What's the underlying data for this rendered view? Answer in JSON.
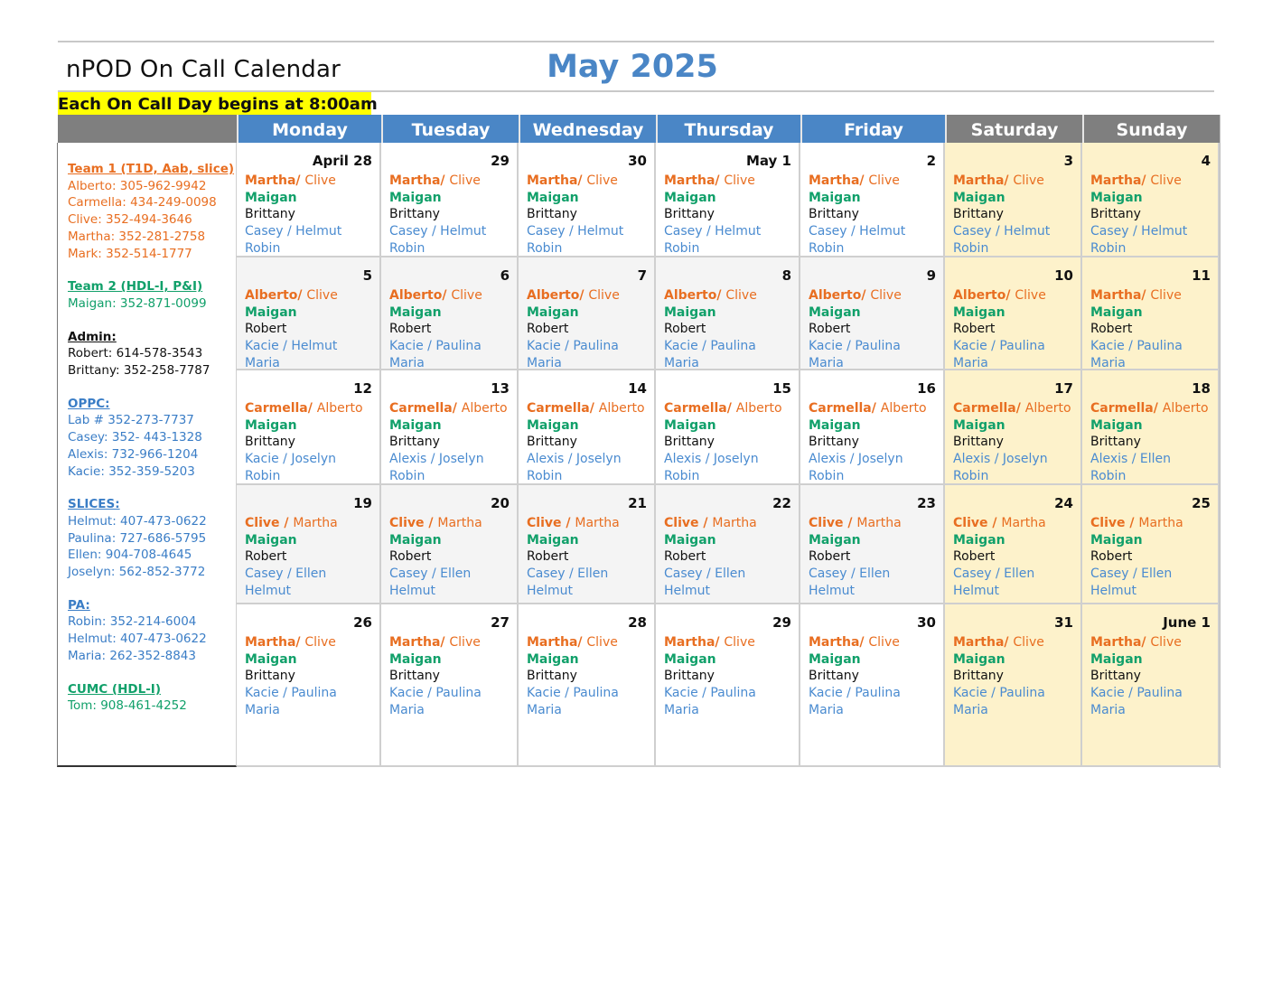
{
  "header": {
    "doc_title": "nPOD On Call Calendar",
    "month_title": "May 2025",
    "note": "Each On Call Day begins at 8:00am"
  },
  "day_names": [
    "Monday",
    "Tuesday",
    "Wednesday",
    "Thursday",
    "Friday",
    "Saturday",
    "Sunday"
  ],
  "contacts": {
    "team1": {
      "heading": "Team 1 (T1D, Aab, slice)",
      "lines": [
        "Alberto: 305-962-9942",
        "Carmella:  434-249-0098",
        "Clive: 352-494-3646",
        "Martha: 352-281-2758",
        "Mark: 352-514-1777"
      ]
    },
    "team2": {
      "heading": "Team 2 (HDL-I, P&I)",
      "lines": [
        "Maigan: 352-871-0099"
      ]
    },
    "admin": {
      "heading": "Admin:",
      "lines": [
        "Robert: 614-578-3543",
        "Brittany: 352-258-7787"
      ]
    },
    "oppc": {
      "heading": "OPPC:",
      "lines": [
        "Lab # 352-273-7737",
        "Casey: 352- 443-1328",
        "Alexis: 732-966-1204",
        "Kacie: 352-359-5203"
      ]
    },
    "slices": {
      "heading": "SLICES:",
      "lines": [
        "Helmut: 407-473-0622",
        "Paulina: 727-686-5795",
        "Ellen: 904-708-4645",
        "Joselyn:  562-852-3772"
      ]
    },
    "pa": {
      "heading": "PA:",
      "lines": [
        "Robin: 352-214-6004",
        "Helmut:  407-473-0622",
        "Maria: 262-352-8843"
      ]
    },
    "cumc": {
      "heading": "CUMC (HDL-I)",
      "lines": [
        "Tom: 908-461-4252"
      ]
    }
  },
  "weeks": [
    [
      {
        "date": "April 28",
        "lead": "Martha",
        "sep": "/ ",
        "second": "Clive",
        "l2": "Maigan",
        "l3": "Brittany",
        "l4": "Casey / Helmut",
        "l5": "Robin"
      },
      {
        "date": "29",
        "lead": "Martha",
        "sep": "/ ",
        "second": "Clive",
        "l2": "Maigan",
        "l3": "Brittany",
        "l4": "Casey / Helmut",
        "l5": "Robin"
      },
      {
        "date": "30",
        "lead": "Martha",
        "sep": "/ ",
        "second": "Clive",
        "l2": "Maigan",
        "l3": "Brittany",
        "l4": "Casey / Helmut",
        "l5": "Robin"
      },
      {
        "date": "May 1",
        "lead": "Martha",
        "sep": "/ ",
        "second": "Clive",
        "l2": "Maigan",
        "l3": "Brittany",
        "l4": "Casey / Helmut",
        "l5": "Robin"
      },
      {
        "date": "2",
        "lead": "Martha",
        "sep": "/ ",
        "second": "Clive",
        "l2": "Maigan",
        "l3": "Brittany",
        "l4": "Casey / Helmut",
        "l5": "Robin"
      },
      {
        "date": "3",
        "lead": "Martha",
        "sep": "/ ",
        "second": "Clive",
        "l2": "Maigan",
        "l3": "Brittany",
        "l4": "Casey / Helmut",
        "l5": "Robin"
      },
      {
        "date": "4",
        "lead": "Martha",
        "sep": "/ ",
        "second": "Clive",
        "l2": "Maigan",
        "l3": "Brittany",
        "l4": "Casey / Helmut",
        "l5": "Robin"
      }
    ],
    [
      {
        "date": "5",
        "lead": "Alberto",
        "sep": "/ ",
        "second": "Clive",
        "l2": "Maigan",
        "l3": "Robert",
        "l4": "Kacie / Helmut",
        "l5": "Maria"
      },
      {
        "date": "6",
        "lead": "Alberto",
        "sep": "/ ",
        "second": "Clive",
        "l2": "Maigan",
        "l3": "Robert",
        "l4": "Kacie / Paulina",
        "l5": "Maria"
      },
      {
        "date": "7",
        "lead": "Alberto",
        "sep": "/ ",
        "second": "Clive",
        "l2": "Maigan",
        "l3": " Robert",
        "l4": "Kacie / Paulina",
        "l5": "Maria"
      },
      {
        "date": "8",
        "lead": "Alberto",
        "sep": "/ ",
        "second": "Clive",
        "l2": "Maigan",
        "l3": "Robert",
        "l4": "Kacie / Paulina",
        "l5": "Maria"
      },
      {
        "date": "9",
        "lead": "Alberto",
        "sep": "/ ",
        "second": "Clive",
        "l2": "Maigan",
        "l3": "Robert",
        "l4": "Kacie / Paulina",
        "l5": "Maria"
      },
      {
        "date": "10",
        "lead": "Alberto",
        "sep": "/ ",
        "second": "Clive",
        "l2": "Maigan",
        "l3": "Robert",
        "l4": "Kacie / Paulina",
        "l5": "Maria"
      },
      {
        "date": "11",
        "lead": "Martha",
        "sep": "/ ",
        "second": "Clive",
        "l2": "Maigan",
        "l3": "Robert",
        "l4": "Kacie / Paulina",
        "l5": "Maria"
      }
    ],
    [
      {
        "date": "12",
        "lead": "Carmella",
        "sep": "/ ",
        "second": "Alberto",
        "l2": "Maigan",
        "l3": "Brittany",
        "l4": "Kacie / Joselyn",
        "l5": "Robin"
      },
      {
        "date": "13",
        "lead": "Carmella",
        "sep": "/ ",
        "second": "Alberto",
        "l2": "Maigan",
        "l3": "Brittany",
        "l4": "Alexis / Joselyn",
        "l5": "Robin"
      },
      {
        "date": "14",
        "lead": "Carmella",
        "sep": "/ ",
        "second": "Alberto",
        "l2": "Maigan",
        "l3": "Brittany",
        "l4": "Alexis / Joselyn",
        "l5": "Robin"
      },
      {
        "date": "15",
        "lead": "Carmella",
        "sep": "/ ",
        "second": "Alberto",
        "l2": "Maigan",
        "l3": "Brittany",
        "l4": "Alexis / Joselyn",
        "l5": "Robin"
      },
      {
        "date": "16",
        "lead": "Carmella",
        "sep": "/ ",
        "second": "Alberto",
        "l2": "Maigan",
        "l3": "Brittany",
        "l4": "Alexis / Joselyn",
        "l5": "Robin"
      },
      {
        "date": "17",
        "lead": "Carmella",
        "sep": "/ ",
        "second": "Alberto",
        "l2": "Maigan",
        "l3": "Brittany",
        "l4": "Alexis / Joselyn",
        "l5": "Robin"
      },
      {
        "date": "18",
        "lead": "Carmella",
        "sep": "/ ",
        "second": "Alberto",
        "l2": "Maigan",
        "l3": "Brittany",
        "l4": "Alexis / Ellen",
        "l5": "Robin"
      }
    ],
    [
      {
        "date": "19",
        "lead": "Clive",
        "sep": " / ",
        "second": "Martha",
        "l2": "Maigan",
        "l3": "Robert",
        "l4": "Casey / Ellen",
        "l5": "Helmut"
      },
      {
        "date": "20",
        "lead": "Clive",
        "sep": " / ",
        "second": "Martha",
        "l2": "Maigan",
        "l3": "Robert",
        "l4": "Casey / Ellen",
        "l5": "Helmut"
      },
      {
        "date": "21",
        "lead": "Clive",
        "sep": " / ",
        "second": "Martha",
        "l2": "Maigan",
        "l3": "Robert",
        "l4": "Casey / Ellen",
        "l5": "Helmut"
      },
      {
        "date": "22",
        "lead": "Clive",
        "sep": " / ",
        "second": "Martha",
        "l2": "Maigan",
        "l3": "Robert",
        "l4": "Casey / Ellen",
        "l5": "Helmut"
      },
      {
        "date": "23",
        "lead": "Clive",
        "sep": " / ",
        "second": "Martha",
        "l2": "Maigan",
        "l3": "Robert",
        "l4": "Casey / Ellen",
        "l5": "Helmut"
      },
      {
        "date": "24",
        "lead": "Clive",
        "sep": " / ",
        "second": "Martha",
        "l2": "Maigan",
        "l3": "Robert",
        "l4": "Casey / Ellen",
        "l5": "Helmut"
      },
      {
        "date": "25",
        "lead": "Clive",
        "sep": " / ",
        "second": "Martha",
        "l2": "Maigan",
        "l3": "Robert",
        "l4": "Casey / Ellen",
        "l5": "Helmut"
      }
    ],
    [
      {
        "date": "26",
        "lead": "Martha",
        "sep": "/ ",
        "second": "Clive",
        "l2": "Maigan",
        "l3": "Brittany",
        "l4": "Kacie / Paulina",
        "l5": "Maria"
      },
      {
        "date": "27",
        "lead": "Martha",
        "sep": "/ ",
        "second": "Clive",
        "l2": "Maigan",
        "l3": "Brittany",
        "l4": "Kacie / Paulina",
        "l5": "Maria"
      },
      {
        "date": "28",
        "lead": "Martha",
        "sep": "/ ",
        "second": "Clive",
        "l2": "Maigan",
        "l3": "Brittany",
        "l4": "Kacie / Paulina",
        "l5": "Maria"
      },
      {
        "date": "29",
        "lead": "Martha",
        "sep": "/ ",
        "second": "Clive",
        "l2": "Maigan",
        "l3": "Brittany",
        "l4": "Kacie / Paulina",
        "l5": "Maria"
      },
      {
        "date": "30",
        "lead": "Martha",
        "sep": "/ ",
        "second": "Clive",
        "l2": "Maigan",
        "l3": "Brittany",
        "l4": "Kacie / Paulina",
        "l5": "Maria"
      },
      {
        "date": "31",
        "lead": "Martha",
        "sep": "/ ",
        "second": "Clive",
        "l2": "Maigan",
        "l3": "Brittany",
        "l4": "Kacie / Paulina",
        "l5": "Maria"
      },
      {
        "date": "June 1",
        "lead": "Martha",
        "sep": "/ ",
        "second": "Clive",
        "l2": "Maigan",
        "l3": "Brittany",
        "l4": "Kacie / Paulina",
        "l5": "Maria"
      }
    ]
  ]
}
